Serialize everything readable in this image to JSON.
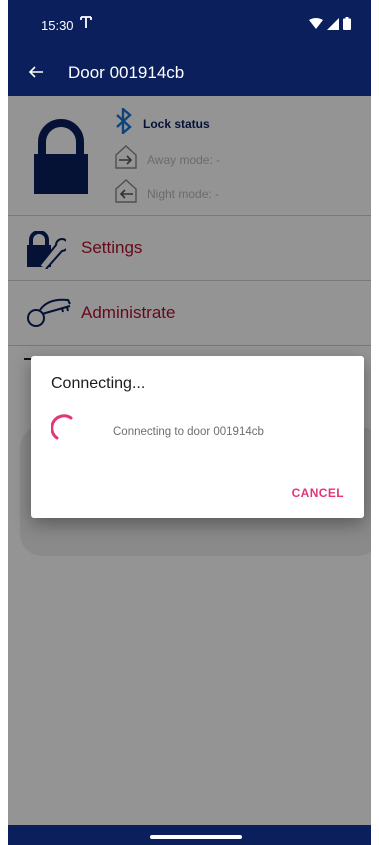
{
  "status_bar": {
    "time": "15:30"
  },
  "app_bar": {
    "title": "Door 001914cb"
  },
  "lock_panel": {
    "lock_status": "Lock status",
    "away_mode": "Away mode: -",
    "night_mode": "Night mode: -"
  },
  "menu": {
    "settings": "Settings",
    "administrate": "Administrate"
  },
  "dialog": {
    "title": "Connecting...",
    "message": "Connecting to door 001914cb",
    "cancel": "CANCEL"
  },
  "colors": {
    "primary": "#0a1f5c",
    "accent": "#e4357a",
    "menu_text": "#b01230",
    "bluetooth": "#1976d2"
  },
  "icons": {
    "back": "arrow-back-icon",
    "antenna": "antenna-icon",
    "wifi": "wifi-icon",
    "signal": "signal-icon",
    "battery": "battery-icon",
    "lock": "lock-icon",
    "bluetooth": "bluetooth-icon",
    "away": "away-mode-icon",
    "night": "night-mode-icon",
    "settings": "settings-icon",
    "administrate": "keys-icon"
  }
}
